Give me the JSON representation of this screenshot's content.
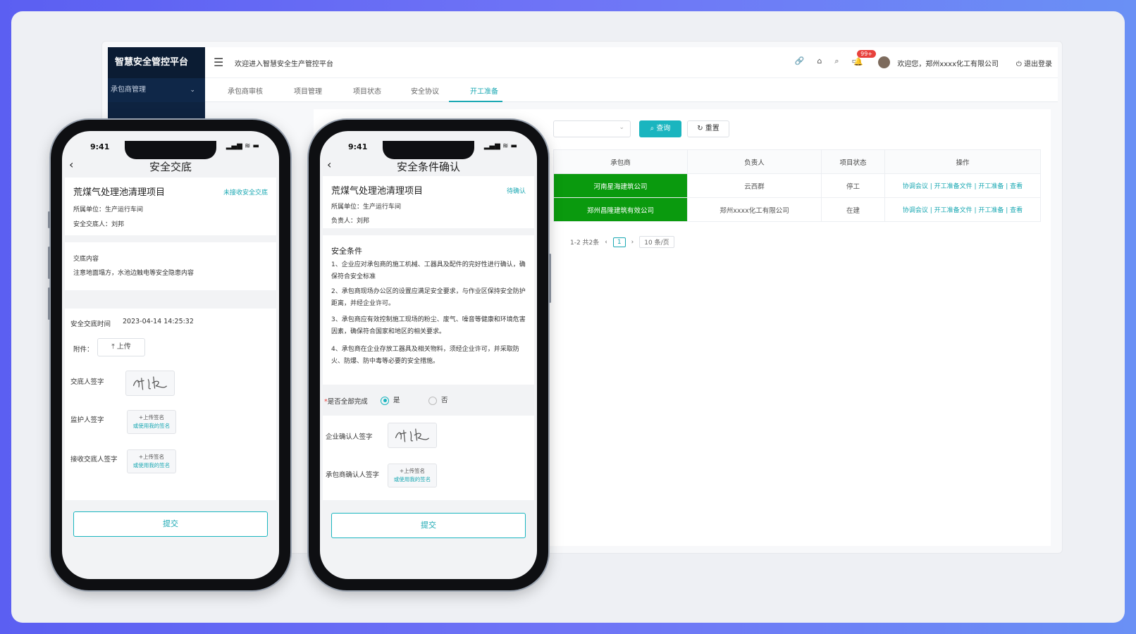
{
  "desktop": {
    "brand": "智慧安全管控平台",
    "sidebar_item": "承包商管理",
    "welcome": "欢迎进入智慧安全生产管控平台",
    "badge": "99+",
    "user": "欢迎您，郑州xxxx化工有限公司",
    "logout": "退出登录",
    "tabs": [
      "承包商审核",
      "项目管理",
      "项目状态",
      "安全协议",
      "开工准备"
    ],
    "active_tab": 4,
    "query_label": "查询",
    "reset_label": "重置",
    "table": {
      "headers": [
        "承包商",
        "负责人",
        "项目状态",
        "操作"
      ],
      "rows": [
        {
          "contractor": "河南星海建筑公司",
          "person": "云西群",
          "status": "停工",
          "ops": "协调会议 | 开工准备文件 | 开工准备 | 查看"
        },
        {
          "contractor": "郑州昌隆建筑有效公司",
          "person": "郑州xxxx化工有限公司",
          "status": "在建",
          "ops": "协调会议 | 开工准备文件 | 开工准备 | 查看"
        }
      ]
    },
    "pager": {
      "total": "1-2 共2条",
      "page": "1",
      "size": "10 条/页"
    }
  },
  "phone1": {
    "time": "9:41",
    "title": "安全交底",
    "project": "荒煤气处理池清理项目",
    "status": "未接收安全交底",
    "unit": "所属单位：生产运行车间",
    "person": "安全交底人：刘邦",
    "content_label": "交底内容",
    "content_text": "注意地面塌方，水池边触电等安全隐患内容",
    "time_label": "安全交底时间",
    "time_value": "2023-04-14 14:25:32",
    "attach_label": "附件：",
    "upload_label": "上传",
    "sign1": "交底人签字",
    "sign2": "监护人签字",
    "sign3": "接收交底人签字",
    "upload_sig": "+上传签名",
    "use_my_sig": "或使用我的签名",
    "submit": "提交"
  },
  "phone2": {
    "time": "9:41",
    "title": "安全条件确认",
    "project": "荒煤气处理池清理项目",
    "status": "待确认",
    "unit": "所属单位：生产运行车间",
    "person": "负责人：刘邦",
    "cond_title": "安全条件",
    "conditions": [
      "1、企业应对承包商的施工机械、工器具及配件的完好性进行确认，确保符合安全标准",
      "2、承包商现场办公区的设置应满足安全要求，与作业区保持安全防护距离，并经企业许可。",
      "3、承包商应有效控制施工现场的粉尘、废气、噪音等健康和环境危害因素，确保符合国家和地区的相关要求。",
      "4、承包商在企业存放工器具及相关物料，须经企业许可，并采取防火、防爆、防中毒等必要的安全措施。"
    ],
    "complete_label": "是否全部完成",
    "yes": "是",
    "no": "否",
    "sign1": "企业确认人签字",
    "sign2": "承包商确认人签字",
    "upload_sig": "+上传签名",
    "use_my_sig": "或使用我的签名",
    "submit": "提交"
  }
}
